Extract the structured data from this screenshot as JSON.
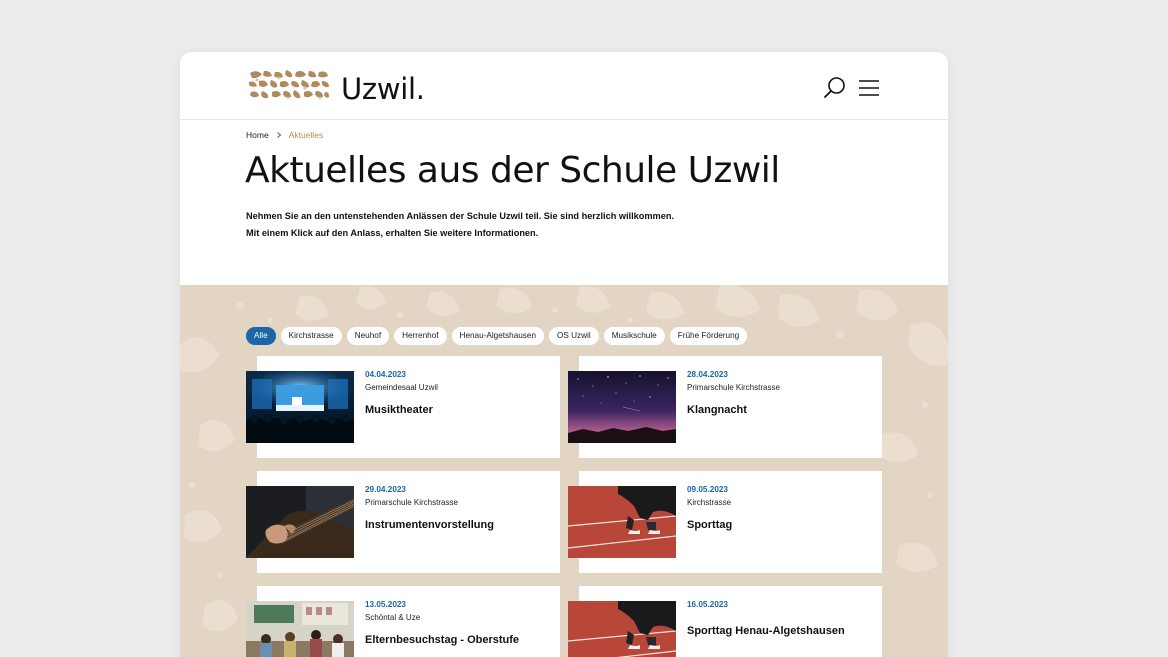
{
  "header": {
    "logo_text": "Uzwil.",
    "search_icon": "search-icon",
    "menu_icon": "hamburger-menu-icon"
  },
  "breadcrumb": {
    "home": "Home",
    "current": "Aktuelles"
  },
  "page": {
    "title": "Aktuelles aus der Schule Uzwil",
    "intro_line1": "Nehmen Sie an den untenstehenden Anlässen der Schule Uzwil teil. Sie sind herzlich willkommen.",
    "intro_line2": "Mit einem Klick auf den Anlass, erhalten Sie weitere Informationen."
  },
  "filters": [
    {
      "label": "Alle",
      "active": true
    },
    {
      "label": "Kirchstrasse",
      "active": false
    },
    {
      "label": "Neuhof",
      "active": false
    },
    {
      "label": "Herrenhof",
      "active": false
    },
    {
      "label": "Henau-Algetshausen",
      "active": false
    },
    {
      "label": "OS Uzwil",
      "active": false
    },
    {
      "label": "Musikschule",
      "active": false
    },
    {
      "label": "Frühe Förderung",
      "active": false
    }
  ],
  "events": [
    {
      "date": "04.04.2023",
      "location": "Gemeindesaal Uzwil",
      "title": "Musiktheater",
      "image": "theater-stage-photo"
    },
    {
      "date": "28.04.2023",
      "location": "Primarschule Kirchstrasse",
      "title": "Klangnacht",
      "image": "night-sky-photo"
    },
    {
      "date": "29.04.2023",
      "location": "Primarschule Kirchstrasse",
      "title": "Instrumentenvorstellung",
      "image": "guitar-photo"
    },
    {
      "date": "09.05.2023",
      "location": "Kirchstrasse",
      "title": "Sporttag",
      "image": "sprinter-start-photo"
    },
    {
      "date": "13.05.2023",
      "location": "Schöntal & Uze",
      "title": "Elternbesuchstag - Oberstufe",
      "image": "classroom-photo"
    },
    {
      "date": "16.05.2023",
      "location": "",
      "title": "Sporttag Henau-Algetshausen",
      "image": "sprinter-start-photo"
    }
  ],
  "colors": {
    "accent_blue": "#1b66a6",
    "breadcrumb_current": "#b58a5a",
    "section_bg": "#e3d5c3",
    "logo_brown": "#b08a5c"
  }
}
